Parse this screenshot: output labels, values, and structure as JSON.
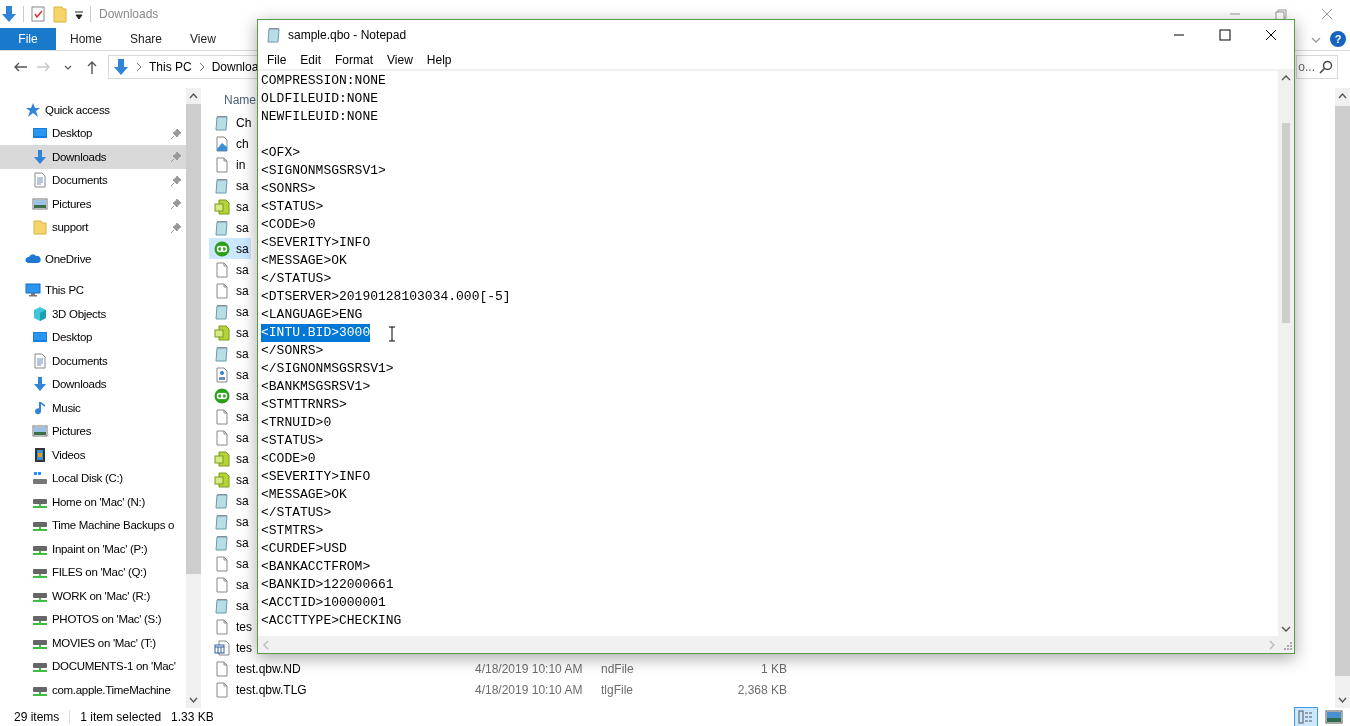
{
  "explorer": {
    "title": "Downloads",
    "ribbon_tabs": [
      {
        "label": "File",
        "selected": true
      },
      {
        "label": "Home",
        "selected": false
      },
      {
        "label": "Share",
        "selected": false
      },
      {
        "label": "View",
        "selected": false
      }
    ],
    "help_label": "?",
    "nav_buttons": [
      {
        "kind": "back",
        "disabled": false
      },
      {
        "kind": "forward",
        "disabled": true
      },
      {
        "kind": "recent",
        "disabled": false
      },
      {
        "kind": "up",
        "disabled": false
      }
    ],
    "breadcrumb": [
      "This PC",
      "Downloa"
    ],
    "search": {
      "placeholder": "o..."
    },
    "navigation": [
      {
        "label": "Quick access",
        "kind": "star",
        "selected": false,
        "children": [
          {
            "label": "Desktop",
            "kind": "desktop",
            "selected": false,
            "pinned": true
          },
          {
            "label": "Downloads",
            "kind": "download",
            "selected": true,
            "pinned": true
          },
          {
            "label": "Documents",
            "kind": "document",
            "selected": false,
            "pinned": true
          },
          {
            "label": "Pictures",
            "kind": "picture",
            "selected": false,
            "pinned": true
          },
          {
            "label": "support",
            "kind": "folder",
            "selected": false,
            "pinned": true
          }
        ]
      },
      {
        "label": "OneDrive",
        "kind": "cloud",
        "selected": false
      },
      {
        "label": "This PC",
        "kind": "pc",
        "selected": false,
        "children": [
          {
            "label": "3D Objects",
            "kind": "cube",
            "selected": false,
            "pinned": false
          },
          {
            "label": "Desktop",
            "kind": "desktop",
            "selected": false,
            "pinned": false
          },
          {
            "label": "Documents",
            "kind": "document",
            "selected": false,
            "pinned": false
          },
          {
            "label": "Downloads",
            "kind": "download",
            "selected": false,
            "pinned": false
          },
          {
            "label": "Music",
            "kind": "music",
            "selected": false,
            "pinned": false
          },
          {
            "label": "Pictures",
            "kind": "picture",
            "selected": false,
            "pinned": false
          },
          {
            "label": "Videos",
            "kind": "video",
            "selected": false,
            "pinned": false
          },
          {
            "label": "Local Disk (C:)",
            "kind": "disk",
            "selected": false,
            "pinned": false
          },
          {
            "label": "Home on 'Mac' (N:)",
            "kind": "network",
            "selected": false,
            "pinned": false
          },
          {
            "label": "Time Machine Backups o",
            "kind": "network",
            "selected": false,
            "pinned": false
          },
          {
            "label": "Inpaint on 'Mac' (P:)",
            "kind": "network",
            "selected": false,
            "pinned": false
          },
          {
            "label": "FILES on 'Mac' (Q:)",
            "kind": "network",
            "selected": false,
            "pinned": false
          },
          {
            "label": "WORK on 'Mac' (R:)",
            "kind": "network",
            "selected": false,
            "pinned": false
          },
          {
            "label": "PHOTOS on 'Mac' (S:)",
            "kind": "network",
            "selected": false,
            "pinned": false
          },
          {
            "label": "MOVIES on 'Mac' (T:)",
            "kind": "network",
            "selected": false,
            "pinned": false
          },
          {
            "label": "DOCUMENTS-1 on 'Mac'",
            "kind": "network",
            "selected": false,
            "pinned": false
          },
          {
            "label": "com.apple.TimeMachine",
            "kind": "network",
            "selected": false,
            "pinned": false
          }
        ]
      }
    ],
    "columns": [
      "Name"
    ],
    "files": [
      {
        "name": "Ch",
        "kind": "notepad",
        "selected": false
      },
      {
        "name": "ch",
        "kind": "image",
        "selected": false
      },
      {
        "name": "in",
        "kind": "blank",
        "selected": false
      },
      {
        "name": "sa",
        "kind": "notepad",
        "selected": false
      },
      {
        "name": "sa",
        "kind": "data",
        "selected": false
      },
      {
        "name": "sa",
        "kind": "notepad",
        "selected": false
      },
      {
        "name": "sa",
        "kind": "qb",
        "selected": true
      },
      {
        "name": "sa",
        "kind": "blank",
        "selected": false
      },
      {
        "name": "sa",
        "kind": "blank",
        "selected": false
      },
      {
        "name": "sa",
        "kind": "notepad",
        "selected": false
      },
      {
        "name": "sa",
        "kind": "data",
        "selected": false
      },
      {
        "name": "sa",
        "kind": "notepad",
        "selected": false
      },
      {
        "name": "sa",
        "kind": "pdf",
        "selected": false
      },
      {
        "name": "sa",
        "kind": "qb",
        "selected": false
      },
      {
        "name": "sa",
        "kind": "blank",
        "selected": false
      },
      {
        "name": "sa",
        "kind": "blank",
        "selected": false
      },
      {
        "name": "sa",
        "kind": "data",
        "selected": false
      },
      {
        "name": "sa",
        "kind": "data",
        "selected": false
      },
      {
        "name": "sa",
        "kind": "notepad",
        "selected": false
      },
      {
        "name": "sa",
        "kind": "notepad",
        "selected": false
      },
      {
        "name": "sa",
        "kind": "notepad",
        "selected": false
      },
      {
        "name": "sa",
        "kind": "blank",
        "selected": false
      },
      {
        "name": "sa",
        "kind": "blank",
        "selected": false
      },
      {
        "name": "sa",
        "kind": "notepad",
        "selected": false
      },
      {
        "name": "tes",
        "kind": "blank",
        "selected": false
      },
      {
        "name": "tes",
        "kind": "table",
        "selected": false
      },
      {
        "name": "test.qbw.ND",
        "kind": "blank",
        "selected": false,
        "date": "4/18/2019 10:10 AM",
        "type": "ndFile",
        "size": "1 KB"
      },
      {
        "name": "test.qbw.TLG",
        "kind": "blank",
        "selected": false,
        "date": "4/18/2019 10:10 AM",
        "type": "tlgFile",
        "size": "2,368 KB"
      }
    ],
    "status": {
      "items": "29 items",
      "selection": "1 item selected",
      "size": "1.33 KB"
    },
    "view_buttons": [
      {
        "kind": "details",
        "selected": true
      },
      {
        "kind": "large-icons",
        "selected": false
      }
    ]
  },
  "notepad": {
    "title": "sample.qbo - Notepad",
    "menu": [
      "File",
      "Edit",
      "Format",
      "View",
      "Help"
    ],
    "lines": [
      {
        "kind": "text",
        "text": "COMPRESSION:NONE",
        "selected": false
      },
      {
        "kind": "text",
        "text": "OLDFILEUID:NONE",
        "selected": false
      },
      {
        "kind": "text",
        "text": "NEWFILEUID:NONE",
        "selected": false
      },
      {
        "kind": "blank"
      },
      {
        "kind": "text",
        "text": "<OFX>",
        "selected": false
      },
      {
        "kind": "text",
        "text": "<SIGNONMSGSRSV1>",
        "selected": false
      },
      {
        "kind": "text",
        "text": "<SONRS>",
        "selected": false
      },
      {
        "kind": "text",
        "text": "<STATUS>",
        "selected": false
      },
      {
        "kind": "text",
        "text": "<CODE>0",
        "selected": false
      },
      {
        "kind": "text",
        "text": "<SEVERITY>INFO",
        "selected": false
      },
      {
        "kind": "text",
        "text": "<MESSAGE>OK",
        "selected": false
      },
      {
        "kind": "text",
        "text": "</STATUS>",
        "selected": false
      },
      {
        "kind": "text",
        "text": "<DTSERVER>20190128103034.000[-5]",
        "selected": false
      },
      {
        "kind": "text",
        "text": "<LANGUAGE>ENG",
        "selected": false
      },
      {
        "kind": "text",
        "text": "<INTU.BID>3000",
        "selected": true
      },
      {
        "kind": "text",
        "text": "</SONRS>",
        "selected": false
      },
      {
        "kind": "text",
        "text": "</SIGNONMSGSRSV1>",
        "selected": false
      },
      {
        "kind": "text",
        "text": "<BANKMSGSRSV1>",
        "selected": false
      },
      {
        "kind": "text",
        "text": "<STMTTRNRS>",
        "selected": false
      },
      {
        "kind": "text",
        "text": "<TRNUID>0",
        "selected": false
      },
      {
        "kind": "text",
        "text": "<STATUS>",
        "selected": false
      },
      {
        "kind": "text",
        "text": "<CODE>0",
        "selected": false
      },
      {
        "kind": "text",
        "text": "<SEVERITY>INFO",
        "selected": false
      },
      {
        "kind": "text",
        "text": "<MESSAGE>OK",
        "selected": false
      },
      {
        "kind": "text",
        "text": "</STATUS>",
        "selected": false
      },
      {
        "kind": "text",
        "text": "<STMTRS>",
        "selected": false
      },
      {
        "kind": "text",
        "text": "<CURDEF>USD",
        "selected": false
      },
      {
        "kind": "text",
        "text": "<BANKACCTFROM>",
        "selected": false
      },
      {
        "kind": "text",
        "text": "<BANKID>122000661",
        "selected": false
      },
      {
        "kind": "text",
        "text": "<ACCTID>10000001",
        "selected": false
      },
      {
        "kind": "text",
        "text": "<ACCTTYPE>CHECKING",
        "selected": false
      }
    ]
  }
}
